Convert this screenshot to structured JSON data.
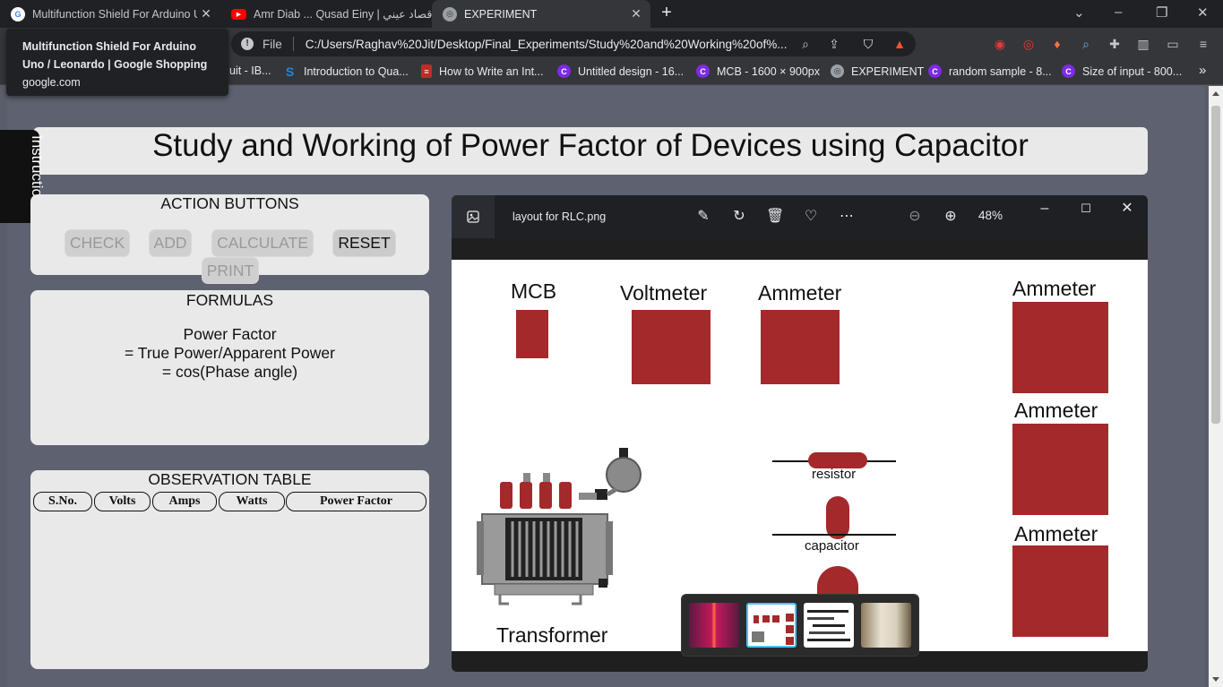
{
  "browser": {
    "tabs": [
      {
        "title": "Multifunction Shield For Arduino U",
        "close": "✕"
      },
      {
        "title": "Amr Diab ... Qusad Einy | قصاد عيني ...",
        "close": "✕"
      },
      {
        "title": "EXPERIMENT",
        "close": "✕"
      }
    ],
    "new_tab": "+",
    "tooltip": {
      "title": "Multifunction Shield For Arduino Uno / Leonardo | Google Shopping",
      "domain": "google.com"
    },
    "omnibox": {
      "scheme": "File",
      "url": "C:/Users/Raghav%20Jit/Desktop/Final_Experiments/Study%20and%20Working%20of%..."
    },
    "bookmarks": [
      {
        "label": "uit - IB..."
      },
      {
        "label": "Introduction to Qua..."
      },
      {
        "label": "How to Write an Int..."
      },
      {
        "label": "Untitled design - 16..."
      },
      {
        "label": "MCB - 1600 × 900px"
      },
      {
        "label": "EXPERIMENT"
      },
      {
        "label": "random sample - 8..."
      },
      {
        "label": "Size of input - 800..."
      }
    ],
    "bookmarks_more": "»"
  },
  "page": {
    "title": "Study and Working of Power Factor of Devices using Capacitor",
    "instructions_tab": "Instructions",
    "action_buttons": {
      "title": "ACTION BUTTONS",
      "check": "CHECK",
      "add": "ADD",
      "calculate": "CALCULATE",
      "reset": "RESET",
      "print": "PRINT"
    },
    "formulas": {
      "title": "FORMULAS",
      "line1": "Power Factor",
      "line2": "= True Power/Apparent Power",
      "line3": "= cos(Phase angle)"
    },
    "observation_table": {
      "title": "OBSERVATION TABLE",
      "columns": [
        "S.No.",
        "Volts",
        "Amps",
        "Watts",
        "Power Factor"
      ],
      "rows": []
    }
  },
  "image_viewer": {
    "filename": "layout for RLC.png",
    "zoom": "48%",
    "image_labels": {
      "mcb": "MCB",
      "voltmeter": "Voltmeter",
      "ammeter1": "Ammeter",
      "ammeter2": "Ammeter",
      "ammeter3": "Ammeter",
      "ammeter4": "Ammeter",
      "resistor": "resistor",
      "capacitor": "capacitor",
      "transformer": "Transformer"
    },
    "component_color": "#a3292b",
    "filmstrip_count": 4,
    "filmstrip_selected": 2
  }
}
